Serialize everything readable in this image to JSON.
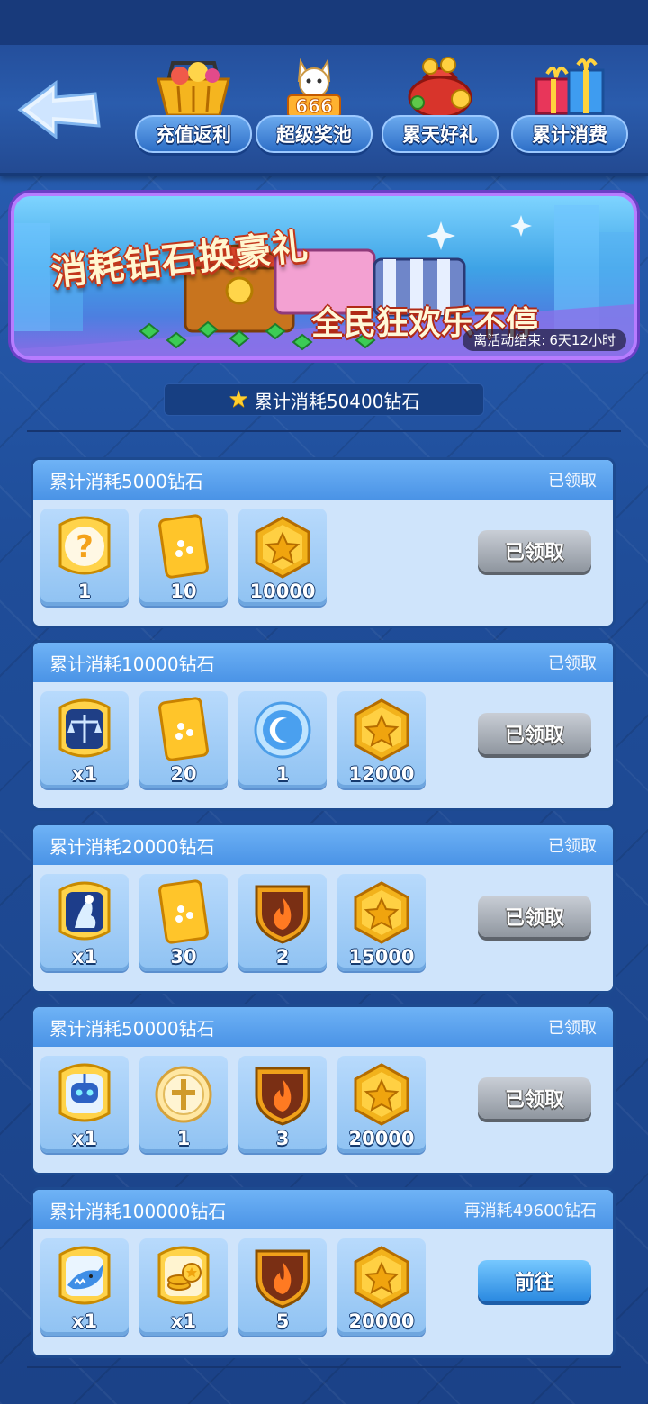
{
  "nav": {
    "tabs": [
      {
        "label": "充值返利",
        "icon": "shopping-basket-icon"
      },
      {
        "label": "超级奖池",
        "icon": "lucky-cat-jackpot-icon"
      },
      {
        "label": "累天好礼",
        "icon": "money-bag-icon"
      },
      {
        "label": "累计消费",
        "icon": "gift-boxes-icon"
      }
    ]
  },
  "banner": {
    "title": "消耗钻石换豪礼",
    "subtitle": "全民狂欢乐不停",
    "countdown_label": "离活动结束:",
    "countdown_value": "6天12小时"
  },
  "total": {
    "text": "累计消耗50400钻石"
  },
  "tiers": [
    {
      "title": "累计消耗5000钻石",
      "status": "已领取",
      "button": "已领取",
      "button_state": "claimed",
      "rewards": [
        {
          "icon": "mystery-question-icon",
          "qty": "1"
        },
        {
          "icon": "dice-card-icon",
          "qty": "10"
        },
        {
          "icon": "gold-coin-icon",
          "qty": "10000"
        }
      ]
    },
    {
      "title": "累计消耗10000钻石",
      "status": "已领取",
      "button": "已领取",
      "button_state": "claimed",
      "rewards": [
        {
          "icon": "scales-badge-icon",
          "qty": "x1"
        },
        {
          "icon": "dice-card-icon",
          "qty": "20"
        },
        {
          "icon": "moon-orb-icon",
          "qty": "1"
        },
        {
          "icon": "gold-coin-icon",
          "qty": "12000"
        }
      ]
    },
    {
      "title": "累计消耗20000钻石",
      "status": "已领取",
      "button": "已领取",
      "button_state": "claimed",
      "rewards": [
        {
          "icon": "angel-badge-icon",
          "qty": "x1"
        },
        {
          "icon": "dice-card-icon",
          "qty": "30"
        },
        {
          "icon": "fire-shield-icon",
          "qty": "2"
        },
        {
          "icon": "gold-coin-icon",
          "qty": "15000"
        }
      ]
    },
    {
      "title": "累计消耗50000钻石",
      "status": "已领取",
      "button": "已领取",
      "button_state": "claimed",
      "rewards": [
        {
          "icon": "robot-badge-icon",
          "qty": "x1"
        },
        {
          "icon": "cross-medallion-icon",
          "qty": "1"
        },
        {
          "icon": "fire-shield-icon",
          "qty": "3"
        },
        {
          "icon": "gold-coin-icon",
          "qty": "20000"
        }
      ]
    },
    {
      "title": "累计消耗100000钻石",
      "status": "再消耗49600钻石",
      "button": "前往",
      "button_state": "goto",
      "rewards": [
        {
          "icon": "shark-badge-icon",
          "qty": "x1"
        },
        {
          "icon": "coin-stack-badge-icon",
          "qty": "x1"
        },
        {
          "icon": "fire-shield-icon",
          "qty": "5"
        },
        {
          "icon": "gold-coin-icon",
          "qty": "20000"
        }
      ]
    }
  ]
}
